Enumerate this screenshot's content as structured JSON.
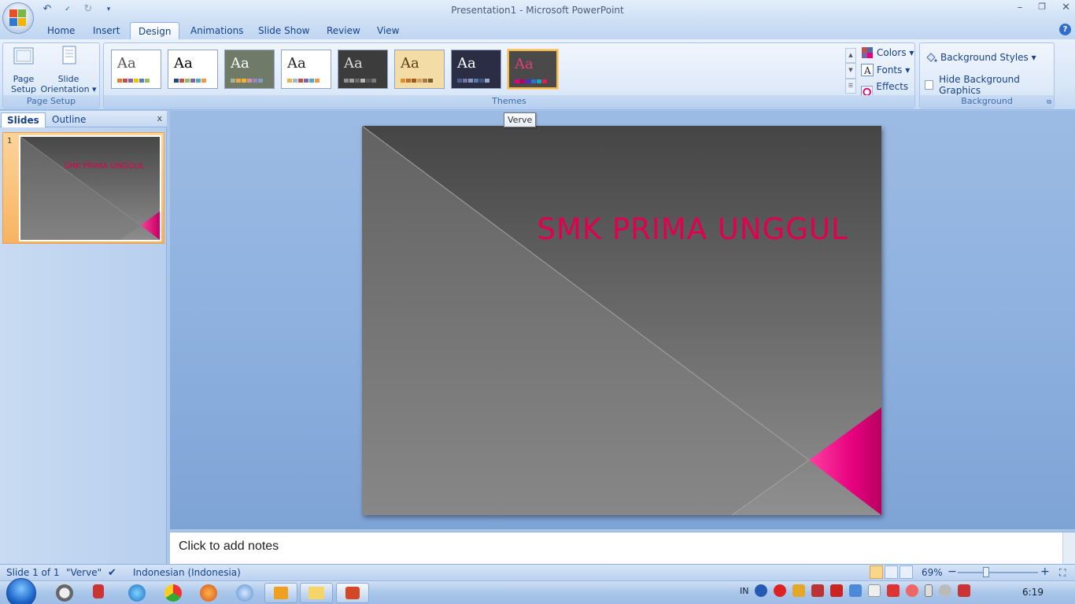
{
  "window": {
    "title": "Presentation1 - Microsoft PowerPoint",
    "controls": [
      "–",
      "❐",
      "✕"
    ]
  },
  "tabs": [
    {
      "label": "Home",
      "active": false
    },
    {
      "label": "Insert",
      "active": false
    },
    {
      "label": "Design",
      "active": true
    },
    {
      "label": "Animations",
      "active": false
    },
    {
      "label": "Slide Show",
      "active": false
    },
    {
      "label": "Review",
      "active": false
    },
    {
      "label": "View",
      "active": false
    }
  ],
  "ribbon": {
    "page_setup": {
      "group_label": "Page Setup",
      "page_setup_line1": "Page",
      "page_setup_line2": "Setup",
      "slide_orientation_line1": "Slide",
      "slide_orientation_line2": "Orientation ▾"
    },
    "themes": {
      "group_label": "Themes",
      "colors_label": "Colors ▾",
      "fonts_label": "Fonts ▾",
      "effects_label": "Effects ▾",
      "items": [
        {
          "aa": "Aa",
          "bg": "#ffffff",
          "fg": "#555555",
          "swatches": [
            "#e27d33",
            "#c0504d",
            "#8064a2",
            "#f5c400",
            "#4f81bd",
            "#9bbb59"
          ]
        },
        {
          "aa": "Aa",
          "bg": "#ffffff",
          "fg": "#000000",
          "swatches": [
            "#1f497d",
            "#c0504d",
            "#9bbb59",
            "#8064a2",
            "#4bacc6",
            "#f79646"
          ]
        },
        {
          "aa": "Aa",
          "bg": "#707a68",
          "fg": "#ffffff",
          "swatches": [
            "#a5b592",
            "#f3a447",
            "#e7bc29",
            "#d092a7",
            "#9c85c0",
            "#809ec2"
          ]
        },
        {
          "aa": "Aa",
          "bg": "#ffffff",
          "fg": "#222222",
          "swatches": [
            "#e8b54d",
            "#9fb8cd",
            "#c0504d",
            "#8064a2",
            "#4bacc6",
            "#f79646"
          ]
        },
        {
          "aa": "Aa",
          "bg": "#3c3c3c",
          "fg": "#dddddd",
          "swatches": [
            "#8f8f8f",
            "#a0a0a0",
            "#6b6b6b",
            "#b5b5b5",
            "#595959",
            "#7a7a7a"
          ]
        },
        {
          "aa": "Aa",
          "bg": "#f4dca6",
          "fg": "#5a3c12",
          "swatches": [
            "#e28d2a",
            "#c76d2c",
            "#9c5b16",
            "#d9a25c",
            "#a47a46",
            "#7c5a2e"
          ]
        },
        {
          "aa": "Aa",
          "bg": "#2a2d44",
          "fg": "#ffffff",
          "swatches": [
            "#4f5f8b",
            "#6e7aa6",
            "#8b95bf",
            "#5a79ad",
            "#3d5583",
            "#99a8cf"
          ]
        },
        {
          "aa": "Aa",
          "bg": "#4a4a4a",
          "fg": "#e53c7a",
          "swatches": [
            "#e5007e",
            "#b7006b",
            "#4b2dc2",
            "#2b6fd8",
            "#15a8c6",
            "#e61e4f"
          ]
        }
      ]
    },
    "background": {
      "group_label": "Background",
      "background_styles_label": "Background Styles ▾",
      "hide_graphics_label": "Hide Background Graphics",
      "hide_graphics_checked": false
    }
  },
  "tooltip": {
    "text": "Verve"
  },
  "left_pane": {
    "tab_slides": "Slides",
    "tab_outline": "Outline",
    "close": "x",
    "thumbnail_number": "1",
    "thumbnail_title": "SMK PRIMA UNGGUL"
  },
  "slide": {
    "title": "SMK PRIMA UNGGUL",
    "title_color": "#e0004f",
    "accent_color": "#e6007e"
  },
  "notes": {
    "placeholder": "Click to add notes"
  },
  "status": {
    "slide_position": "Slide 1 of 1",
    "theme_name": "\"Verve\"",
    "language": "Indonesian (Indonesia)",
    "zoom": "69%",
    "zoom_minus": "−",
    "zoom_plus": "+"
  },
  "taskbar": {
    "language": "IN",
    "clock": "6:19"
  }
}
